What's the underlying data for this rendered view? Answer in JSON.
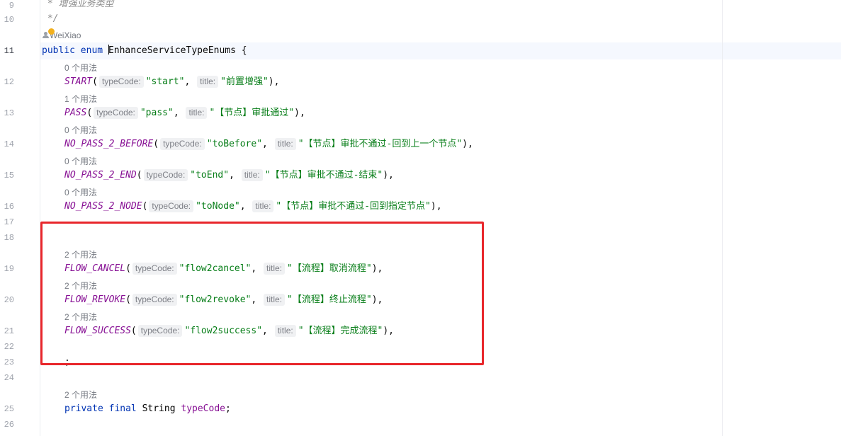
{
  "editor": {
    "line_numbers": [
      "9",
      "10",
      "11",
      "12",
      "13",
      "14",
      "15",
      "16",
      "17",
      "18",
      "19",
      "20",
      "21",
      "22",
      "23",
      "24",
      "25",
      "26"
    ],
    "comment_line_9": " * 增强业务类型",
    "comment_line_10": " */",
    "author": "WeiXiao",
    "enum_decl": {
      "modifier": "public",
      "keyword": "enum",
      "name": "EnhanceServiceTypeEnums",
      "brace": " {"
    },
    "param_hint_1": "typeCode:",
    "param_hint_2": "title:",
    "constants": [
      {
        "usage": "0 个用法",
        "name": "START",
        "code": "\"start\"",
        "title": "\"前置增强\""
      },
      {
        "usage": "1 个用法",
        "name": "PASS",
        "code": "\"pass\"",
        "title": "\"【节点】审批通过\""
      },
      {
        "usage": "0 个用法",
        "name": "NO_PASS_2_BEFORE",
        "code": "\"toBefore\"",
        "title": "\"【节点】审批不通过-回到上一个节点\""
      },
      {
        "usage": "0 个用法",
        "name": "NO_PASS_2_END",
        "code": "\"toEnd\"",
        "title": "\"【节点】审批不通过-结束\""
      },
      {
        "usage": "0 个用法",
        "name": "NO_PASS_2_NODE",
        "code": "\"toNode\"",
        "title": "\"【节点】审批不通过-回到指定节点\""
      },
      {
        "usage": "2 个用法",
        "name": "FLOW_CANCEL",
        "code": "\"flow2cancel\"",
        "title": "\"【流程】取消流程\""
      },
      {
        "usage": "2 个用法",
        "name": "FLOW_REVOKE",
        "code": "\"flow2revoke\"",
        "title": "\"【流程】终止流程\""
      },
      {
        "usage": "2 个用法",
        "name": "FLOW_SUCCESS",
        "code": "\"flow2success\"",
        "title": "\"【流程】完成流程\""
      }
    ],
    "semicolon_line": ";",
    "field": {
      "usage": "2 个用法",
      "modifiers": "private final",
      "type": "String",
      "name": "typeCode",
      "end": ";"
    },
    "colors": {
      "keyword": "#0033b3",
      "constant": "#871094",
      "string": "#067d17",
      "highlight_box": "#e8262b"
    }
  }
}
